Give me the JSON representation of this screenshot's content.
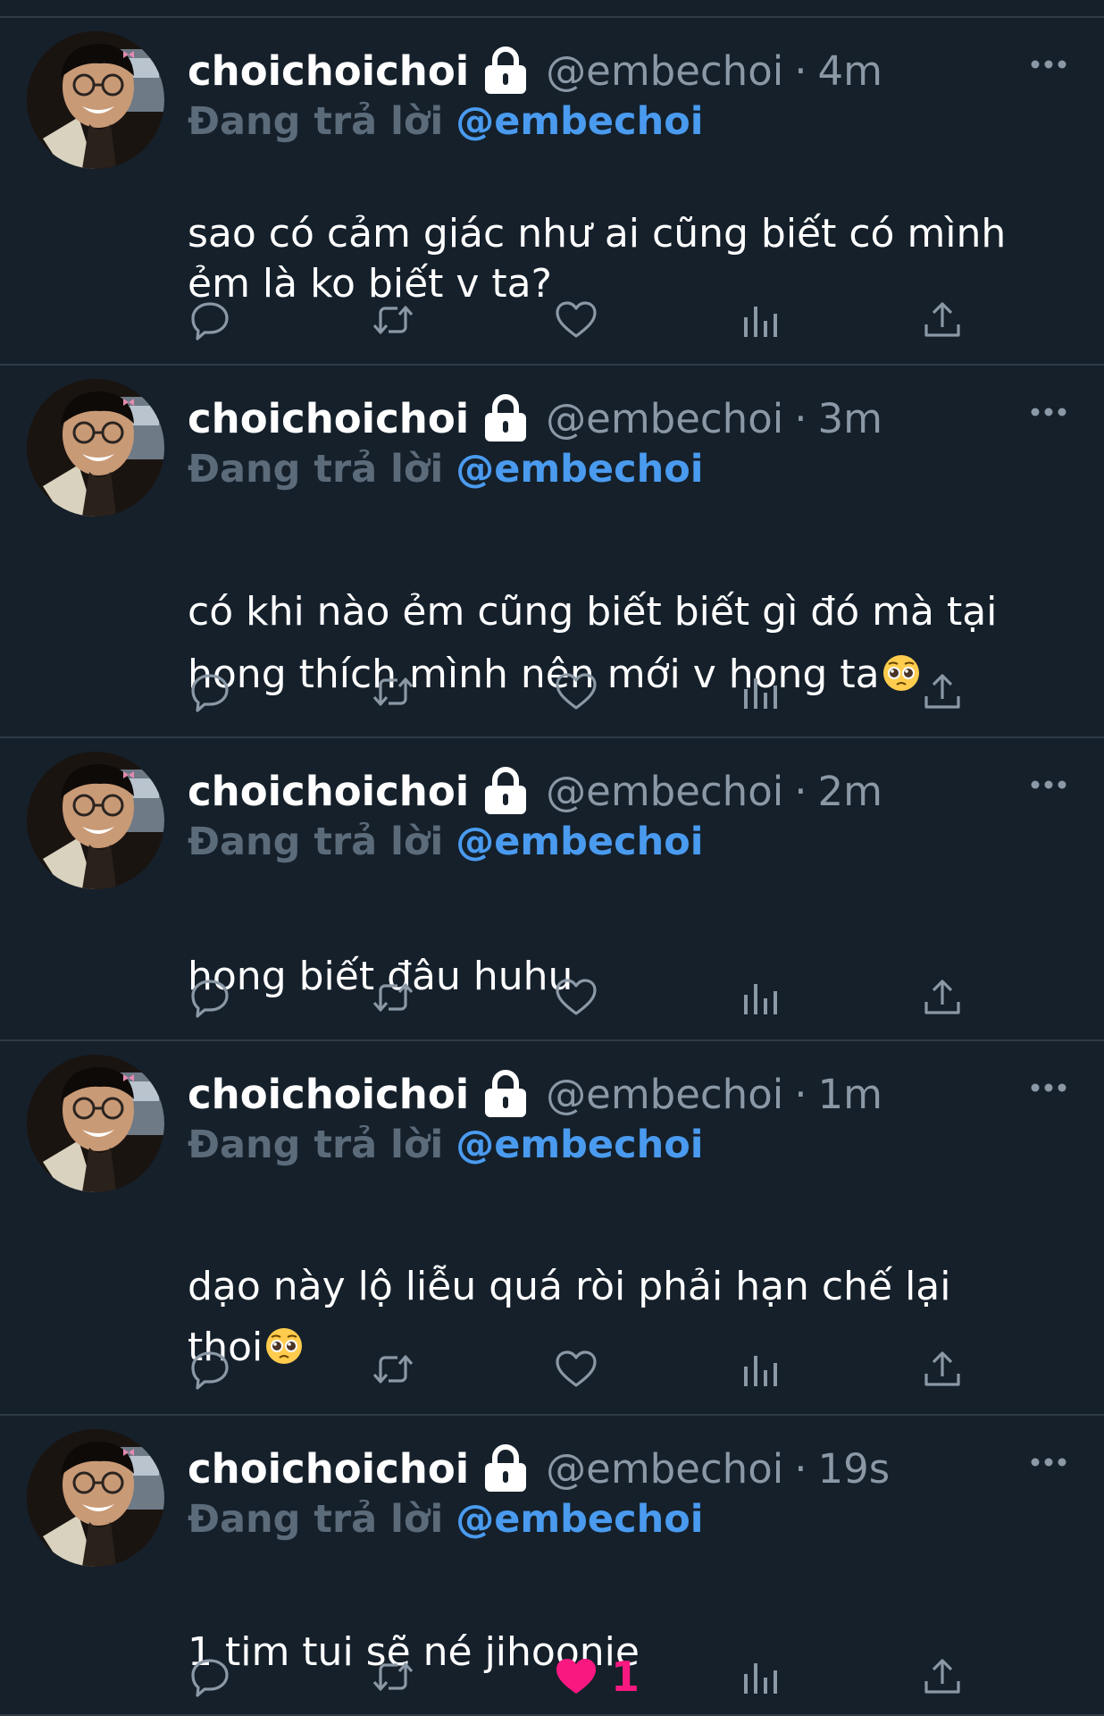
{
  "tweets": [
    {
      "display_name": "choichoichoi",
      "handle": "@embechoi",
      "separator": "·",
      "time": "4m",
      "replying_label": "Đang trả lời",
      "replying_handle": "@embechoi",
      "text": "sao có cảm giác như ai cũng biết có mình\nẻm là ko biết v ta?",
      "emoji": "",
      "liked": false,
      "like_count": ""
    },
    {
      "display_name": "choichoichoi",
      "handle": "@embechoi",
      "separator": "·",
      "time": "3m",
      "replying_label": "Đang trả lời",
      "replying_handle": "@embechoi",
      "text": "có khi nào ẻm cũng biết biết gì đó mà tại\nhong thích mình nên mới v hong ta",
      "emoji": "pleading-face-emoji",
      "liked": false,
      "like_count": ""
    },
    {
      "display_name": "choichoichoi",
      "handle": "@embechoi",
      "separator": "·",
      "time": "2m",
      "replying_label": "Đang trả lời",
      "replying_handle": "@embechoi",
      "text": "hong biết đâu huhu",
      "emoji": "",
      "liked": false,
      "like_count": ""
    },
    {
      "display_name": "choichoichoi",
      "handle": "@embechoi",
      "separator": "·",
      "time": "1m",
      "replying_label": "Đang trả lời",
      "replying_handle": "@embechoi",
      "text": "dạo này lộ liễu quá ròi phải hạn chế lại\nthoi",
      "emoji": "pleading-face-emoji",
      "liked": false,
      "like_count": ""
    },
    {
      "display_name": "choichoichoi",
      "handle": "@embechoi",
      "separator": "·",
      "time": "19s",
      "replying_label": "Đang trả lời",
      "replying_handle": "@embechoi",
      "text": "1 tim tui sẽ né jihoonie",
      "emoji": "",
      "liked": true,
      "like_count": "1"
    }
  ],
  "icons": {
    "lock": "lock-icon",
    "more": "more-options-icon",
    "reply": "reply-icon",
    "retweet": "retweet-icon",
    "like": "heart-icon",
    "views": "analytics-icon",
    "share": "share-icon"
  },
  "colors": {
    "background": "#15202b",
    "divider": "#2f3b47",
    "text": "#ffffff",
    "muted": "#8b98a5",
    "mention": "#4a9bef",
    "like": "#f91880"
  }
}
